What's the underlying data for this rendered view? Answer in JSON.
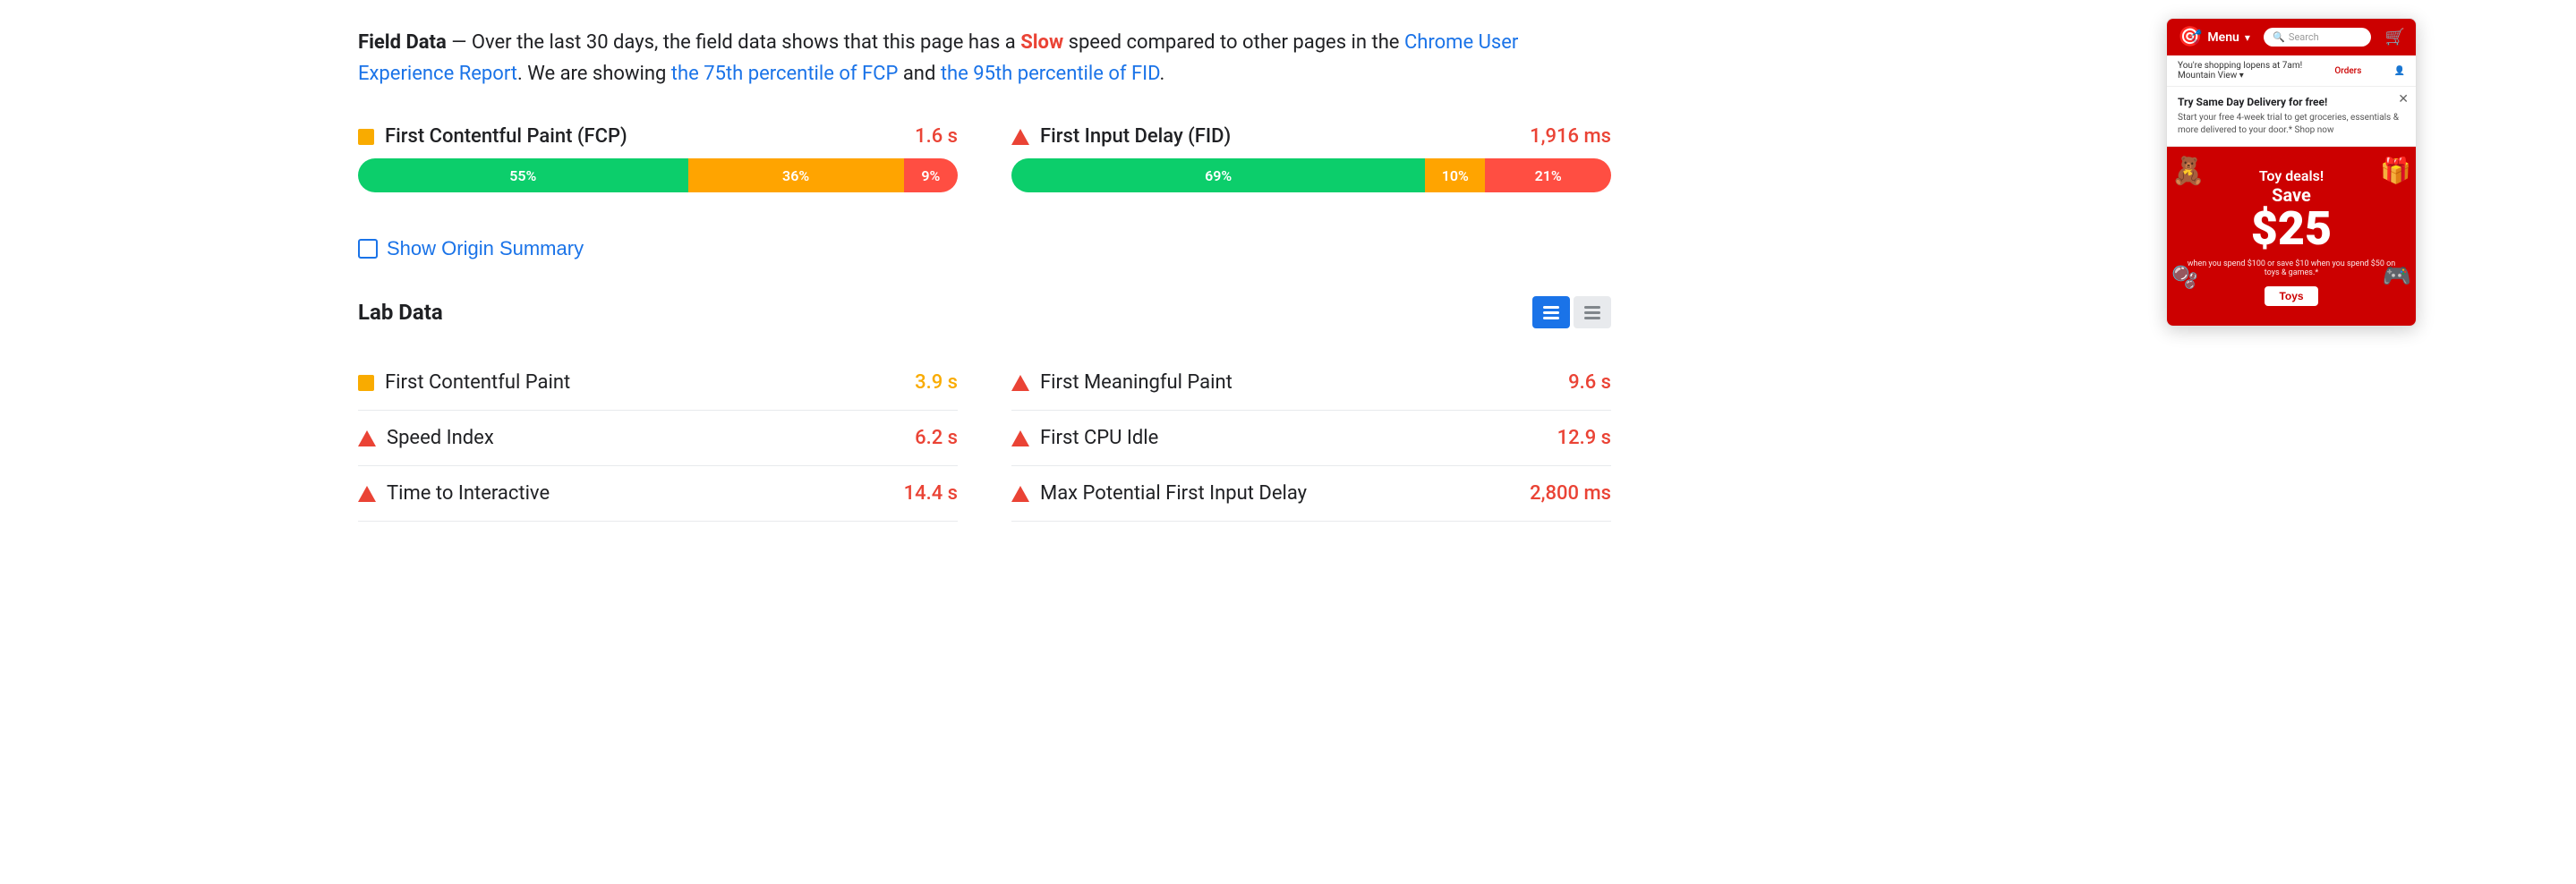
{
  "fieldData": {
    "intro_bold": "Field Data",
    "intro_dash": " — Over the last 30 days, the field data shows that this page has a ",
    "slow_label": "Slow",
    "intro_rest": " speed compared to other pages in the ",
    "crux_link": "Chrome User Experience Report",
    "intro_mid": ". We are showing ",
    "fcp_link": "the 75th percentile of FCP",
    "intro_and": " and ",
    "fid_link": "the 95th percentile of FID",
    "intro_end": "."
  },
  "metrics": [
    {
      "id": "fcp",
      "icon": "orange-square",
      "name": "First Contentful Paint (FCP)",
      "value": "1.6 s",
      "bars": [
        {
          "label": "55%",
          "width": 55,
          "type": "green"
        },
        {
          "label": "36%",
          "width": 36,
          "type": "orange"
        },
        {
          "label": "9%",
          "width": 9,
          "type": "red"
        }
      ]
    },
    {
      "id": "fid",
      "icon": "red-triangle",
      "name": "First Input Delay (FID)",
      "value": "1,916 ms",
      "bars": [
        {
          "label": "69%",
          "width": 69,
          "type": "green"
        },
        {
          "label": "10%",
          "width": 10,
          "type": "orange"
        },
        {
          "label": "21%",
          "width": 21,
          "type": "red"
        }
      ]
    }
  ],
  "originSummary": {
    "label": "Show Origin Summary"
  },
  "labData": {
    "title": "Lab Data",
    "toggle_list_active": true,
    "metrics_left": [
      {
        "icon": "orange-square",
        "name": "First Contentful Paint",
        "value": "3.9 s",
        "color": "orange"
      },
      {
        "icon": "red-triangle",
        "name": "Speed Index",
        "value": "6.2 s",
        "color": "red"
      },
      {
        "icon": "red-triangle",
        "name": "Time to Interactive",
        "value": "14.4 s",
        "color": "red"
      }
    ],
    "metrics_right": [
      {
        "icon": "red-triangle",
        "name": "First Meaningful Paint",
        "value": "9.6 s",
        "color": "red"
      },
      {
        "icon": "red-triangle",
        "name": "First CPU Idle",
        "value": "12.9 s",
        "color": "red"
      },
      {
        "icon": "red-triangle",
        "name": "Max Potential First Input Delay",
        "value": "2,800 ms",
        "color": "red"
      }
    ]
  },
  "targetAd": {
    "menu_label": "Menu",
    "search_placeholder": "Search",
    "shopping_text": "You're shopping lopens at 7am!",
    "location": "Mountain View",
    "orders_label": "Orders",
    "notification_title": "Try Same Day Delivery for free!",
    "notification_text": "Start your free 4-week trial to get groceries, essentials & more delivered to your door.* Shop now",
    "ad_tag": "Toy deals!",
    "save_label": "Save",
    "price": "$25",
    "fine_print": "when you spend $100 or save $10 when you spend $50 on toys & games.*",
    "toys_btn": "Toys"
  },
  "colors": {
    "green": "#0cce6b",
    "orange": "#ffa400",
    "red": "#ff4e42",
    "blue": "#1a73e8",
    "red_dark": "#ea4335",
    "target_red": "#cc0000"
  }
}
